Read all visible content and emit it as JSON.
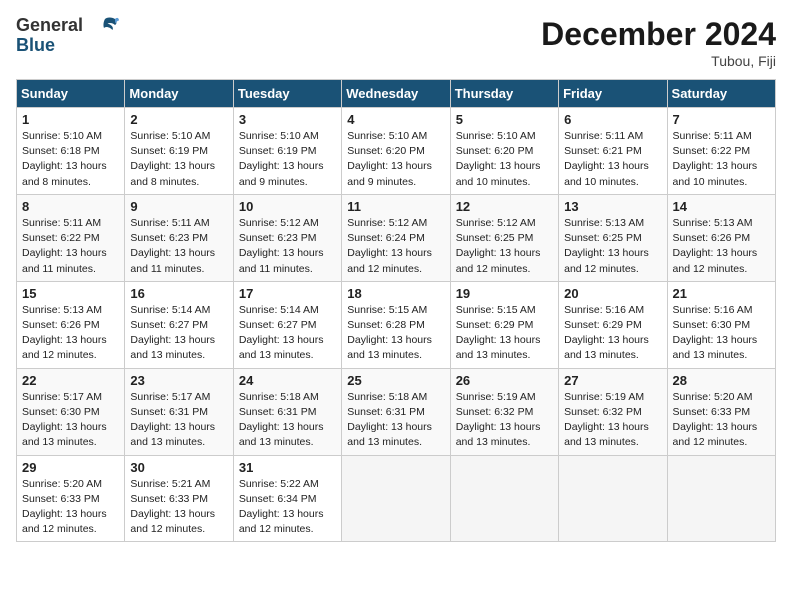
{
  "header": {
    "logo_general": "General",
    "logo_blue": "Blue",
    "month": "December 2024",
    "location": "Tubou, Fiji"
  },
  "weekdays": [
    "Sunday",
    "Monday",
    "Tuesday",
    "Wednesday",
    "Thursday",
    "Friday",
    "Saturday"
  ],
  "weeks": [
    [
      {
        "day": "1",
        "sunrise": "5:10 AM",
        "sunset": "6:18 PM",
        "daylight": "13 hours and 8 minutes."
      },
      {
        "day": "2",
        "sunrise": "5:10 AM",
        "sunset": "6:19 PM",
        "daylight": "13 hours and 8 minutes."
      },
      {
        "day": "3",
        "sunrise": "5:10 AM",
        "sunset": "6:19 PM",
        "daylight": "13 hours and 9 minutes."
      },
      {
        "day": "4",
        "sunrise": "5:10 AM",
        "sunset": "6:20 PM",
        "daylight": "13 hours and 9 minutes."
      },
      {
        "day": "5",
        "sunrise": "5:10 AM",
        "sunset": "6:20 PM",
        "daylight": "13 hours and 10 minutes."
      },
      {
        "day": "6",
        "sunrise": "5:11 AM",
        "sunset": "6:21 PM",
        "daylight": "13 hours and 10 minutes."
      },
      {
        "day": "7",
        "sunrise": "5:11 AM",
        "sunset": "6:22 PM",
        "daylight": "13 hours and 10 minutes."
      }
    ],
    [
      {
        "day": "8",
        "sunrise": "5:11 AM",
        "sunset": "6:22 PM",
        "daylight": "13 hours and 11 minutes."
      },
      {
        "day": "9",
        "sunrise": "5:11 AM",
        "sunset": "6:23 PM",
        "daylight": "13 hours and 11 minutes."
      },
      {
        "day": "10",
        "sunrise": "5:12 AM",
        "sunset": "6:23 PM",
        "daylight": "13 hours and 11 minutes."
      },
      {
        "day": "11",
        "sunrise": "5:12 AM",
        "sunset": "6:24 PM",
        "daylight": "13 hours and 12 minutes."
      },
      {
        "day": "12",
        "sunrise": "5:12 AM",
        "sunset": "6:25 PM",
        "daylight": "13 hours and 12 minutes."
      },
      {
        "day": "13",
        "sunrise": "5:13 AM",
        "sunset": "6:25 PM",
        "daylight": "13 hours and 12 minutes."
      },
      {
        "day": "14",
        "sunrise": "5:13 AM",
        "sunset": "6:26 PM",
        "daylight": "13 hours and 12 minutes."
      }
    ],
    [
      {
        "day": "15",
        "sunrise": "5:13 AM",
        "sunset": "6:26 PM",
        "daylight": "13 hours and 12 minutes."
      },
      {
        "day": "16",
        "sunrise": "5:14 AM",
        "sunset": "6:27 PM",
        "daylight": "13 hours and 13 minutes."
      },
      {
        "day": "17",
        "sunrise": "5:14 AM",
        "sunset": "6:27 PM",
        "daylight": "13 hours and 13 minutes."
      },
      {
        "day": "18",
        "sunrise": "5:15 AM",
        "sunset": "6:28 PM",
        "daylight": "13 hours and 13 minutes."
      },
      {
        "day": "19",
        "sunrise": "5:15 AM",
        "sunset": "6:29 PM",
        "daylight": "13 hours and 13 minutes."
      },
      {
        "day": "20",
        "sunrise": "5:16 AM",
        "sunset": "6:29 PM",
        "daylight": "13 hours and 13 minutes."
      },
      {
        "day": "21",
        "sunrise": "5:16 AM",
        "sunset": "6:30 PM",
        "daylight": "13 hours and 13 minutes."
      }
    ],
    [
      {
        "day": "22",
        "sunrise": "5:17 AM",
        "sunset": "6:30 PM",
        "daylight": "13 hours and 13 minutes."
      },
      {
        "day": "23",
        "sunrise": "5:17 AM",
        "sunset": "6:31 PM",
        "daylight": "13 hours and 13 minutes."
      },
      {
        "day": "24",
        "sunrise": "5:18 AM",
        "sunset": "6:31 PM",
        "daylight": "13 hours and 13 minutes."
      },
      {
        "day": "25",
        "sunrise": "5:18 AM",
        "sunset": "6:31 PM",
        "daylight": "13 hours and 13 minutes."
      },
      {
        "day": "26",
        "sunrise": "5:19 AM",
        "sunset": "6:32 PM",
        "daylight": "13 hours and 13 minutes."
      },
      {
        "day": "27",
        "sunrise": "5:19 AM",
        "sunset": "6:32 PM",
        "daylight": "13 hours and 13 minutes."
      },
      {
        "day": "28",
        "sunrise": "5:20 AM",
        "sunset": "6:33 PM",
        "daylight": "13 hours and 12 minutes."
      }
    ],
    [
      {
        "day": "29",
        "sunrise": "5:20 AM",
        "sunset": "6:33 PM",
        "daylight": "13 hours and 12 minutes."
      },
      {
        "day": "30",
        "sunrise": "5:21 AM",
        "sunset": "6:33 PM",
        "daylight": "13 hours and 12 minutes."
      },
      {
        "day": "31",
        "sunrise": "5:22 AM",
        "sunset": "6:34 PM",
        "daylight": "13 hours and 12 minutes."
      },
      null,
      null,
      null,
      null
    ]
  ]
}
